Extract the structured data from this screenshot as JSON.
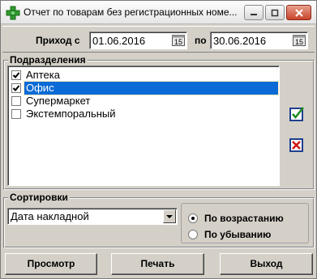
{
  "window": {
    "title": "Отчет по товарам без регистрационных номе...",
    "icon": "plus-icon",
    "controls": [
      "minimize-icon",
      "maximize-icon",
      "close-icon"
    ]
  },
  "dates": {
    "from_label": "Приход с",
    "from_value": "01.06.2016",
    "to_label": "по",
    "to_value": "30.06.2016",
    "calendar_glyph": "15"
  },
  "departments": {
    "title": "Подразделения",
    "items": [
      {
        "label": "Аптека",
        "checked": true
      },
      {
        "label": "Офис",
        "checked": true,
        "selected": true
      },
      {
        "label": "Супермаркет",
        "checked": false
      },
      {
        "label": "Экстемпоральный",
        "checked": false
      }
    ],
    "side_buttons": [
      "select-all-icon",
      "deselect-all-icon"
    ]
  },
  "sorting": {
    "title": "Сортировки",
    "selected": "Дата накладной",
    "order_options": [
      {
        "label": "По возрастанию",
        "checked": true
      },
      {
        "label": "По убыванию",
        "checked": false
      }
    ]
  },
  "buttons": {
    "preview": "Просмотр",
    "print": "Печать",
    "exit": "Выход"
  },
  "colors": {
    "selection": "#0a6ad6",
    "face": "#d4d0c8",
    "icon_green": "#2e9a2e"
  }
}
